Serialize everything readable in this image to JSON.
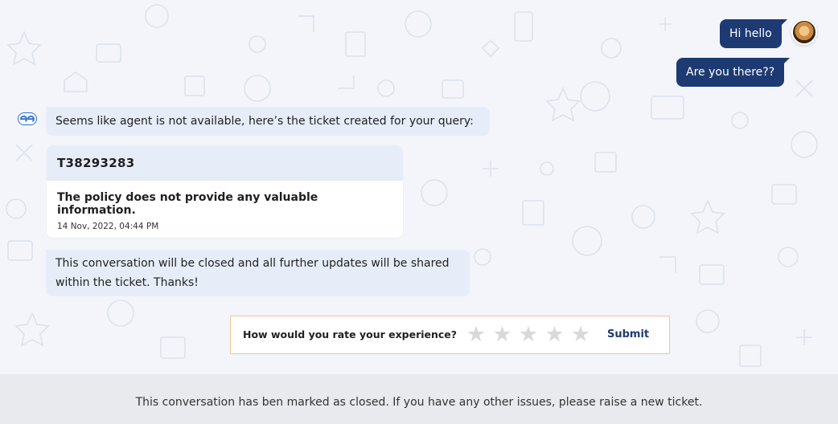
{
  "messages": {
    "outgoing": [
      {
        "text": "Hi hello"
      },
      {
        "text": "Are you there??"
      }
    ],
    "incoming_1": "Seems like agent is not available, here’s the ticket created for your query:",
    "incoming_2": "This conversation will be closed and all further updates will be shared within the ticket. Thanks!"
  },
  "ticket": {
    "id": "T38293283",
    "description": "The policy does not provide any valuable information.",
    "timestamp": "14 Nov, 2022, 04:44 PM"
  },
  "rating": {
    "question": "How would you rate your experience?",
    "stars_total": 5,
    "stars_selected": 0,
    "star_glyph": "★",
    "submit_label": "Submit"
  },
  "footer": {
    "notice": "This conversation has ben marked as closed. If you have any other issues, please raise a new ticket."
  },
  "colors": {
    "primary": "#1d3a73",
    "incoming_bubble": "#e6edf9",
    "rating_border": "#f2c398",
    "star_empty": "#d9d9d9",
    "background": "#f3f5fa",
    "footer_bg": "#e9eaee"
  },
  "icons": {
    "bot": "bot-logo-icon",
    "avatar": "user-avatar",
    "star": "star-icon"
  }
}
